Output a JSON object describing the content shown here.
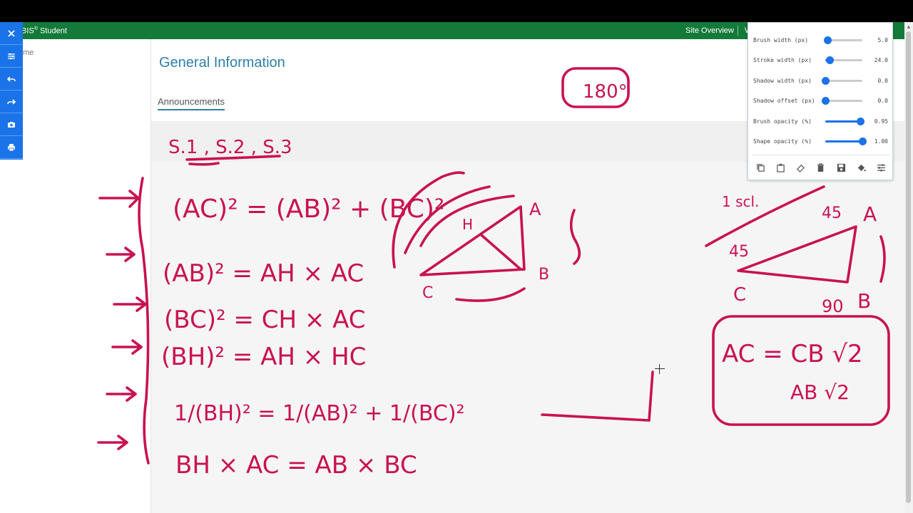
{
  "navbar": {
    "brand": "BIS",
    "brand_sup": "®",
    "brand_suffix": " Student",
    "site_overview": "Site Overview",
    "truncated_link": "W"
  },
  "sidebar": {
    "home_fragment": "me"
  },
  "main": {
    "title": "General Information",
    "tabs": [
      {
        "label": "Announcements",
        "active": true
      }
    ]
  },
  "annotation_toolbar": {
    "tools": [
      {
        "name": "close",
        "icon": "close-icon"
      },
      {
        "name": "settings",
        "icon": "sliders-icon"
      },
      {
        "name": "undo",
        "icon": "undo-icon"
      },
      {
        "name": "redo",
        "icon": "redo-icon"
      },
      {
        "name": "screenshot",
        "icon": "camera-icon"
      },
      {
        "name": "print",
        "icon": "printer-icon"
      }
    ],
    "color": "#1a73e8"
  },
  "brush_settings": {
    "rows": [
      {
        "label": "Brush width (px)",
        "value": "5.0",
        "fraction": 0.05
      },
      {
        "label": "Stroke width (px)",
        "value": "24.0",
        "fraction": 0.12
      },
      {
        "label": "Shadow width (px)",
        "value": "0.0",
        "fraction": 0.0
      },
      {
        "label": "Shadow offset (px)",
        "value": "0.0",
        "fraction": 0.0
      },
      {
        "label": "Brush opacity (%)",
        "value": "0.95",
        "fraction": 0.95
      },
      {
        "label": "Shape opacity (%)",
        "value": "1.00",
        "fraction": 1.0
      }
    ],
    "actions": [
      "copy-icon",
      "paste-icon",
      "eraser-icon",
      "trash-icon",
      "save-icon",
      "fill-icon",
      "tune-icon"
    ]
  },
  "ink": {
    "color": "#c8124f",
    "labels": {
      "box_180": "180°",
      "sections": "S.1 , S.2 , S.3",
      "eq1": "(AC)² = (AB)² + (BC)²",
      "eq2": "(AB)² = AH × AC",
      "eq3": "(BC)² = CH × AC",
      "eq4": "(BH)² = AH × HC",
      "eq5": "1/(BH)² = 1/(AB)² + 1/(BC)²",
      "eq6": "BH × AC = AB × BC",
      "tri1_A": "A",
      "tri1_B": "B",
      "tri1_C": "C",
      "tri1_H": "H",
      "tri2_A": "A",
      "tri2_B": "B",
      "tri2_C": "C",
      "tri2_45a": "45",
      "tri2_45b": "45",
      "tri2_90": "90",
      "scale": "1 scl.",
      "box_eq1": "AC = CB √2",
      "box_eq2": "AB √2"
    }
  }
}
